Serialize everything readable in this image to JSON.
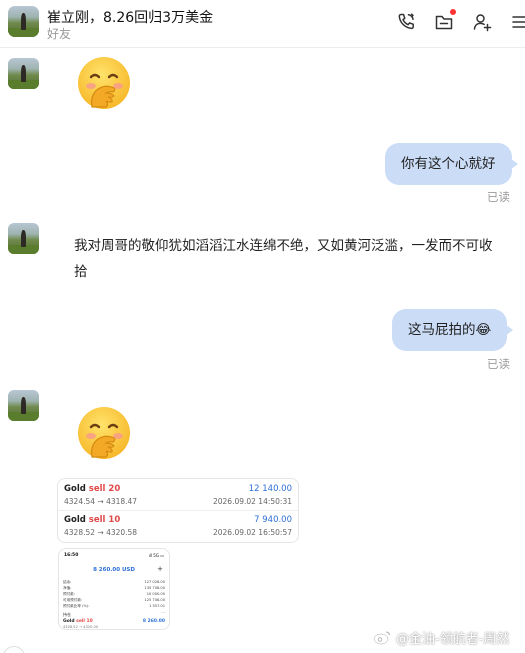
{
  "header": {
    "title": "崔立刚，8.26回归3万美金",
    "subtitle": "好友",
    "icons": [
      "phone-sync-icon",
      "folder-notify-icon",
      "add-contact-icon",
      "more-icon"
    ],
    "notify_color": "#ff3333"
  },
  "messages": [
    {
      "side": "left",
      "type": "emoji",
      "emoji": "face-with-hand-over-mouth"
    },
    {
      "side": "right",
      "type": "text",
      "text": "你有这个心就好",
      "status": "已读"
    },
    {
      "side": "left",
      "type": "text",
      "text": "我对周哥的敬仰犹如滔滔江水连绵不绝，又如黄河泛滥，一发而不可收拾"
    },
    {
      "side": "right",
      "type": "text",
      "text": "这马屁拍的😂",
      "status": "已读"
    },
    {
      "side": "left",
      "type": "emoji",
      "emoji": "face-with-hand-over-mouth"
    }
  ],
  "trades": [
    {
      "asset": "Gold",
      "side": "sell 20",
      "profit": "12 140.00",
      "prices": "4324.54 → 4318.47",
      "time": "2026.09.02 14:50:31"
    },
    {
      "asset": "Gold",
      "side": "sell 10",
      "profit": "7 940.00",
      "prices": "4328.52 → 4320.58",
      "time": "2026.09.02 16:50:57"
    }
  ],
  "phone": {
    "time": "16:50",
    "status": "ıll 5G ▭",
    "balance": "8 260.00 USD",
    "rows": [
      {
        "k": "结余:",
        "v": "127 028.00"
      },
      {
        "k": "净值:",
        "v": "135 708.00"
      },
      {
        "k": "预付款:",
        "v": "10 000.00"
      },
      {
        "k": "可用预付款:",
        "v": "125 708.00"
      },
      {
        "k": "预付款比率 (%):",
        "v": "1 357.01"
      }
    ],
    "section": "持仓",
    "ellipsis": "···",
    "asset": "Gold",
    "asset_side": "sell 10",
    "profit": "8 260.00",
    "sub": "4328.52 → 4320.00"
  },
  "colors": {
    "bubble_right": "#cbdcf7",
    "profit_blue": "#2d6fd6",
    "sell_red": "#e04848",
    "read_gray": "#9a9a9a"
  },
  "watermark": "@金油-领航者-周然"
}
